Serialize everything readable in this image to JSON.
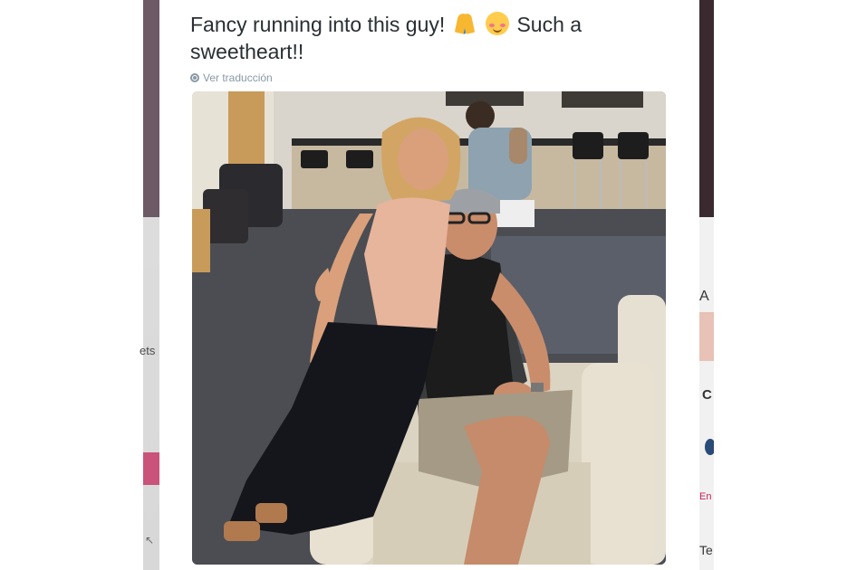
{
  "tweet": {
    "text_part1": "Fancy running into this guy! ",
    "text_part2": " Such a sweetheart!!",
    "emojis": [
      "folded-hands-emoji",
      "smiling-blushing-face-emoji"
    ],
    "translate_label": "Ver traducción"
  },
  "background": {
    "left_fragment": "ets",
    "right_fragment_1": "A",
    "right_fragment_2": "C",
    "right_fragment_red": "En",
    "right_fragment_bottom": "Te"
  },
  "colors": {
    "tweet_text": "#292f33",
    "muted": "#8899a6"
  }
}
